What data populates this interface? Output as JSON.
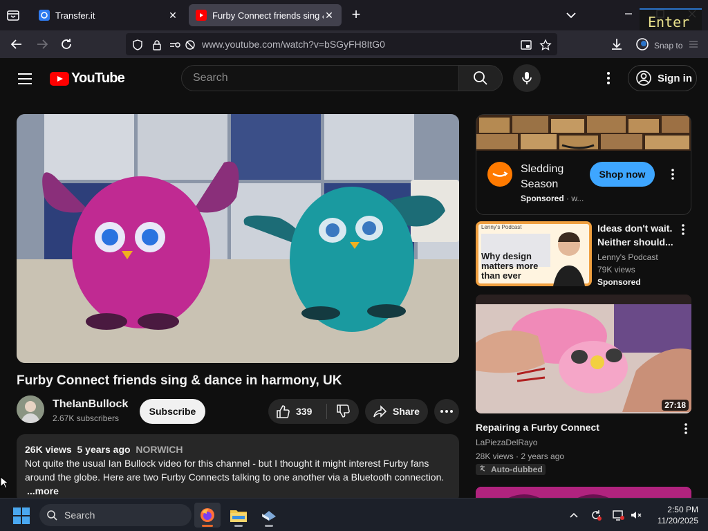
{
  "browser": {
    "tabs": [
      {
        "title": "Transfer.it",
        "active": false
      },
      {
        "title": "Furby Connect friends sing & dance in harmony, UK",
        "active": true
      }
    ],
    "url": "www.youtube.com/watch?v=bSGyFH8ItG0",
    "overlay_key": "Enter",
    "overlay_snap": "Snap to"
  },
  "youtube": {
    "logo_text": "YouTube",
    "search_placeholder": "Search",
    "sign_in_label": "Sign in",
    "video": {
      "title": "Furby Connect friends sing & dance in harmony, UK",
      "channel": "TheIanBullock",
      "subscribers": "2.67K subscribers",
      "subscribe_label": "Subscribe",
      "likes": "339",
      "share_label": "Share",
      "views": "26K views",
      "age": "5 years ago",
      "location": "NORWICH",
      "description": "Not quite the usual Ian Bullock video for this channel - but I thought it might interest Furby fans around the globe. Here are two Furby Connects talking to one another via a Bluetooth connection.",
      "more_label": "...more"
    },
    "ad": {
      "title": "Sledding Season",
      "sponsored": "Sponsored",
      "sponsored_suffix": " · w...",
      "cta": "Shop now"
    },
    "recommendations": [
      {
        "title": "Ideas don't wait. Neither should...",
        "channel": "Lenny's Podcast",
        "views": "79K views",
        "badge": "Sponsored",
        "thumb_label": "Lenny's Podcast",
        "thumb_text": "Why design matters more than ever"
      },
      {
        "title": "Repairing a Furby Connect",
        "channel": "LaPiezaDelRayo",
        "views": "28K views",
        "age": "2 years ago",
        "badge": "Auto-dubbed",
        "duration": "27:18"
      }
    ]
  },
  "taskbar": {
    "search_label": "Search",
    "time": "2:50 PM",
    "date": "11/20/2025"
  },
  "colors": {
    "yt_bg": "#0f0f0f",
    "brand_red": "#ff0000",
    "shop_blue": "#3ea6ff",
    "chip_bg": "#272727"
  }
}
